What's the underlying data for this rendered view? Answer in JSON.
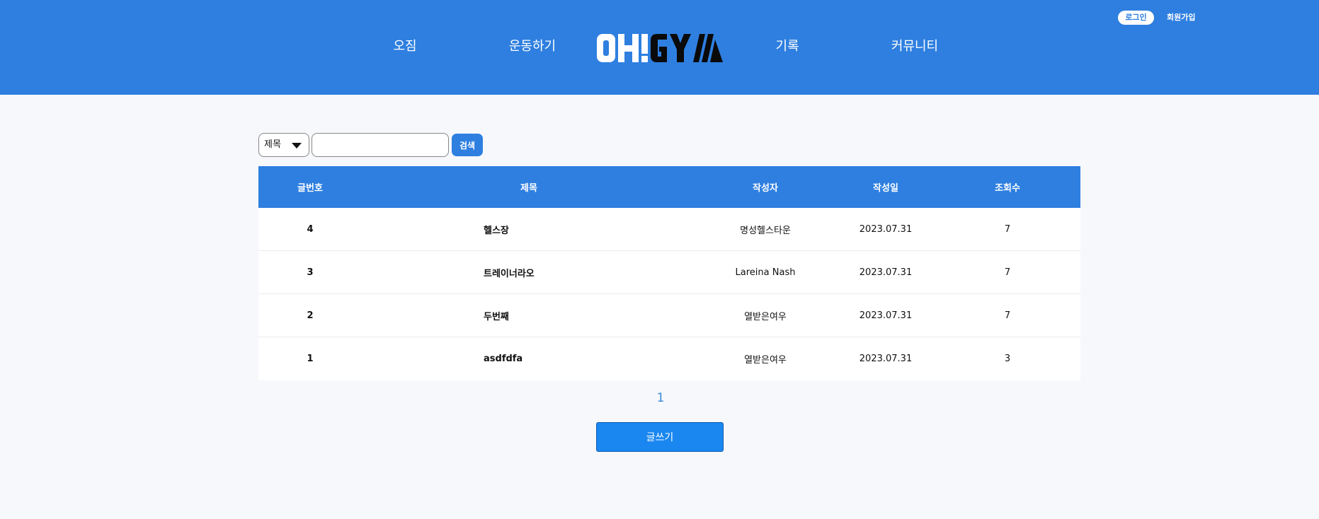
{
  "header": {
    "nav": [
      "오짐",
      "운동하기",
      "기록",
      "커뮤니티"
    ],
    "logo_text": "OH!GYM",
    "login": "로그인",
    "signup": "회원가입"
  },
  "search": {
    "select_value": "제목",
    "input_value": "",
    "button": "검색"
  },
  "table": {
    "headers": [
      "글번호",
      "제목",
      "작성자",
      "작성일",
      "조회수"
    ],
    "rows": [
      {
        "no": "4",
        "title": "헬스장",
        "author": "명성헬스타운",
        "date": "2023.07.31",
        "views": "7"
      },
      {
        "no": "3",
        "title": "트레이너라오",
        "author": "Lareina Nash",
        "date": "2023.07.31",
        "views": "7"
      },
      {
        "no": "2",
        "title": "두번째",
        "author": "열받은여우",
        "date": "2023.07.31",
        "views": "7"
      },
      {
        "no": "1",
        "title": "asdfdfa",
        "author": "열받은여우",
        "date": "2023.07.31",
        "views": "3"
      }
    ]
  },
  "pagination": {
    "current": "1"
  },
  "write_button": "글쓰기",
  "colors": {
    "primary": "#2e7fe0",
    "background": "#f6f8fc",
    "logo_dark": "#0a0a0a"
  }
}
